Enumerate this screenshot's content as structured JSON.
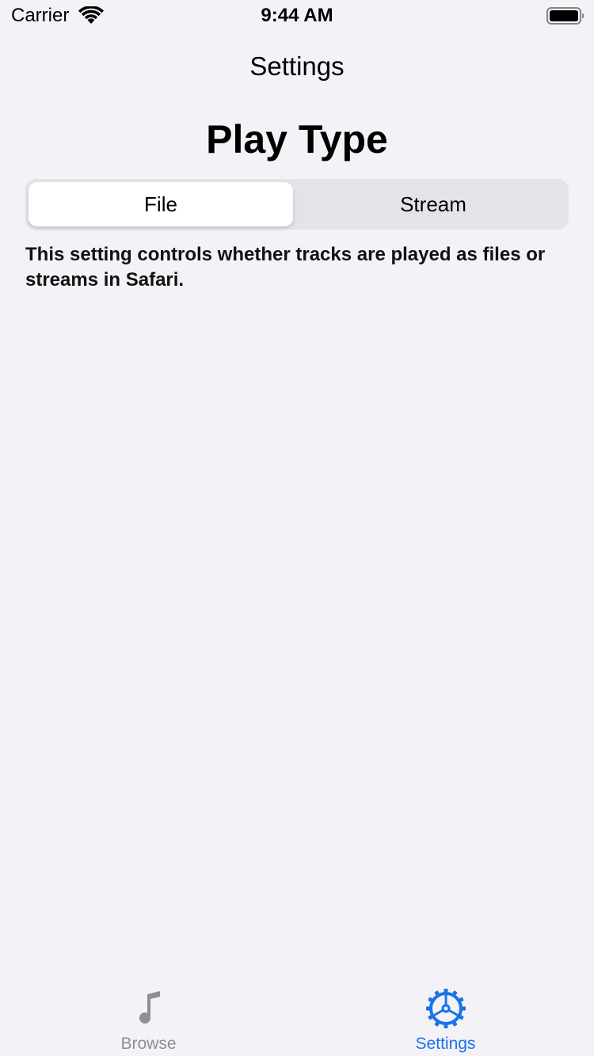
{
  "status_bar": {
    "carrier": "Carrier",
    "time": "9:44 AM",
    "wifi_icon": "wifi-icon",
    "battery_icon": "battery-full-icon"
  },
  "nav": {
    "title": "Settings"
  },
  "play_type": {
    "title": "Play Type",
    "segments": [
      {
        "label": "File",
        "selected": true
      },
      {
        "label": "Stream",
        "selected": false
      }
    ],
    "description": "This setting controls whether tracks are played as files or streams in Safari."
  },
  "tab_bar": {
    "items": [
      {
        "label": "Browse",
        "icon": "music-note-icon",
        "active": false
      },
      {
        "label": "Settings",
        "icon": "gear-icon",
        "active": true
      }
    ],
    "active_color": "#1a73e8",
    "inactive_color": "#8e8e93"
  },
  "colors": {
    "background": "#f2f2f7",
    "segment_track": "#e3e3e8",
    "segment_selected": "#ffffff"
  }
}
